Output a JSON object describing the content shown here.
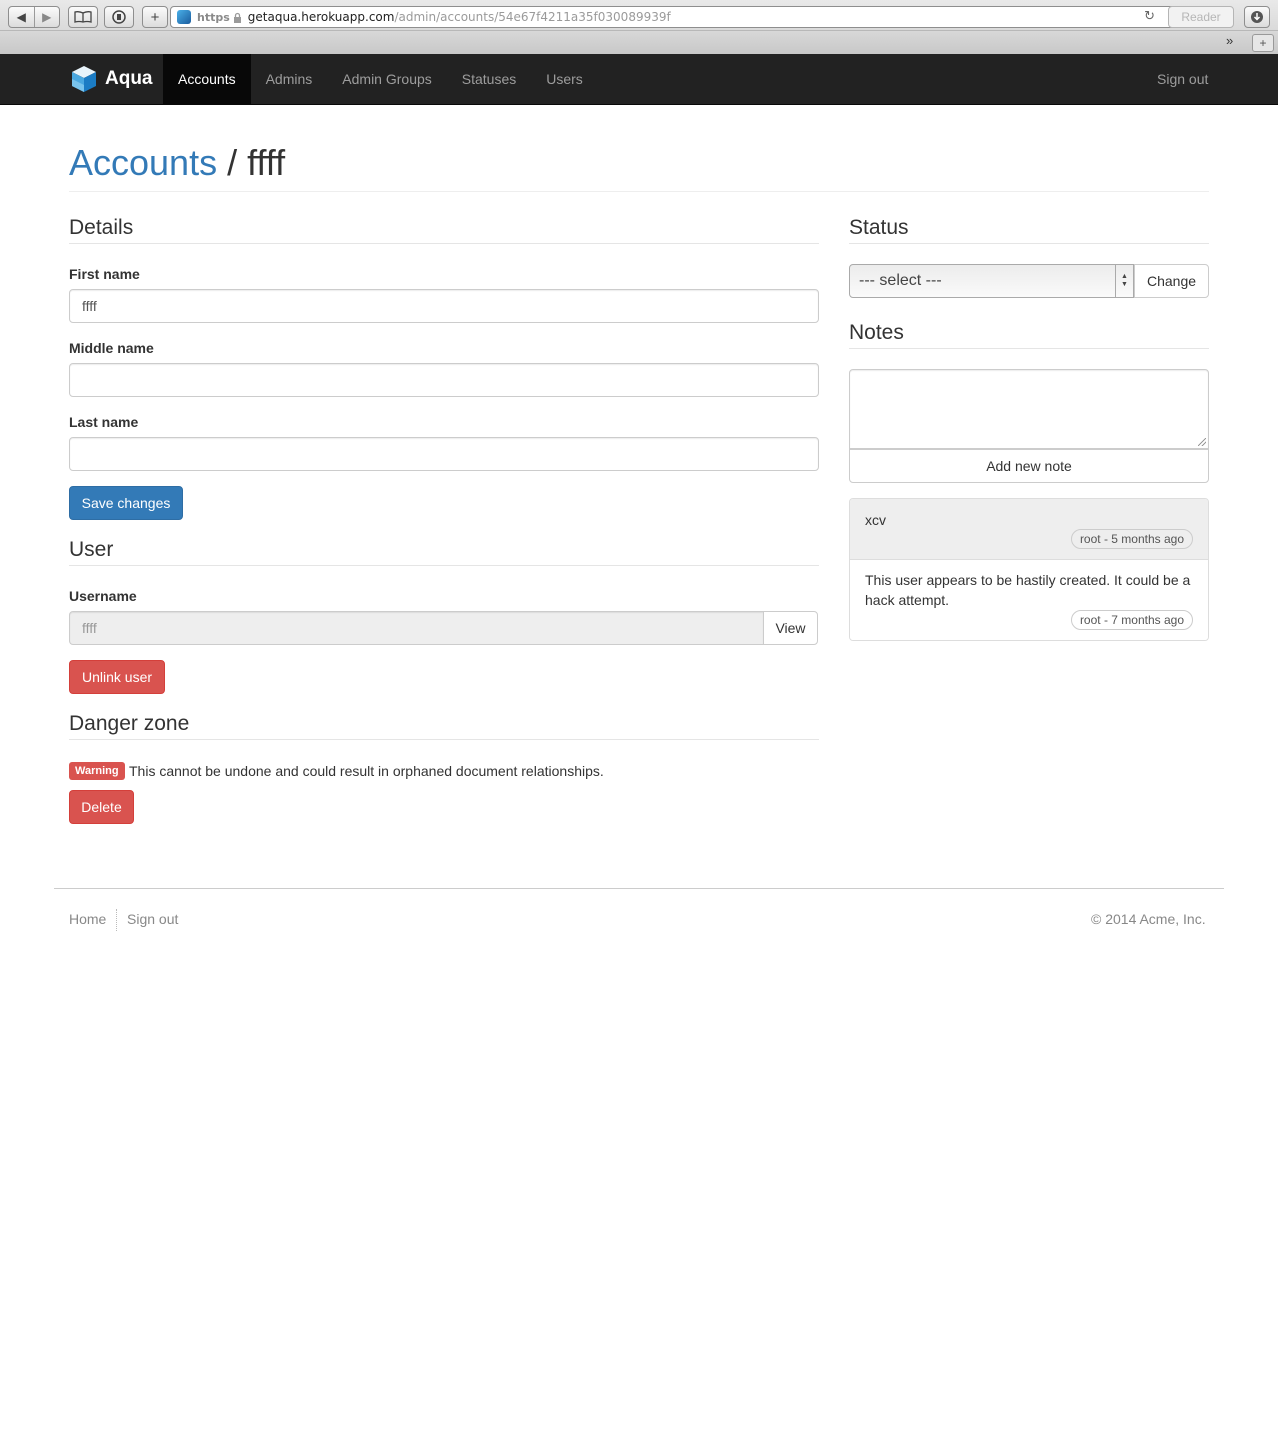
{
  "browser": {
    "protocol": "https",
    "host": "getaqua.herokuapp.com",
    "path": "/admin/accounts/54e67f4211a35f030089939f",
    "reader_label": "Reader",
    "more_glyph": "»",
    "add_glyph": "+"
  },
  "navbar": {
    "brand": "Aqua",
    "items": [
      {
        "label": "Accounts",
        "active": true
      },
      {
        "label": "Admins",
        "active": false
      },
      {
        "label": "Admin Groups",
        "active": false
      },
      {
        "label": "Statuses",
        "active": false
      },
      {
        "label": "Users",
        "active": false
      }
    ],
    "sign_out": "Sign out"
  },
  "page": {
    "breadcrumb": "Accounts",
    "separator": " / ",
    "title": "ffff"
  },
  "details": {
    "heading": "Details",
    "first_name_label": "First name",
    "first_name_value": "ffff",
    "middle_name_label": "Middle name",
    "middle_name_value": "",
    "last_name_label": "Last name",
    "last_name_value": "",
    "save_label": "Save changes"
  },
  "user": {
    "heading": "User",
    "username_label": "Username",
    "username_value": "ffff",
    "view_label": "View",
    "unlink_label": "Unlink user"
  },
  "danger": {
    "heading": "Danger zone",
    "badge": "Warning",
    "message": "This cannot be undone and could result in orphaned document relationships.",
    "delete_label": "Delete"
  },
  "status": {
    "heading": "Status",
    "select_value": "--- select ---",
    "change_label": "Change"
  },
  "notes": {
    "heading": "Notes",
    "textarea_value": "",
    "add_label": "Add new note",
    "items": [
      {
        "text": "xcv",
        "meta": "root - 5 months ago"
      },
      {
        "text": "This user appears to be hastily created. It could be a hack attempt.",
        "meta": "root - 7 months ago"
      }
    ]
  },
  "footer": {
    "home": "Home",
    "sign_out": "Sign out",
    "copyright": "© 2014 Acme, Inc."
  },
  "colors": {
    "primary": "#337ab7",
    "danger": "#d9534f",
    "navbar": "#222222"
  }
}
